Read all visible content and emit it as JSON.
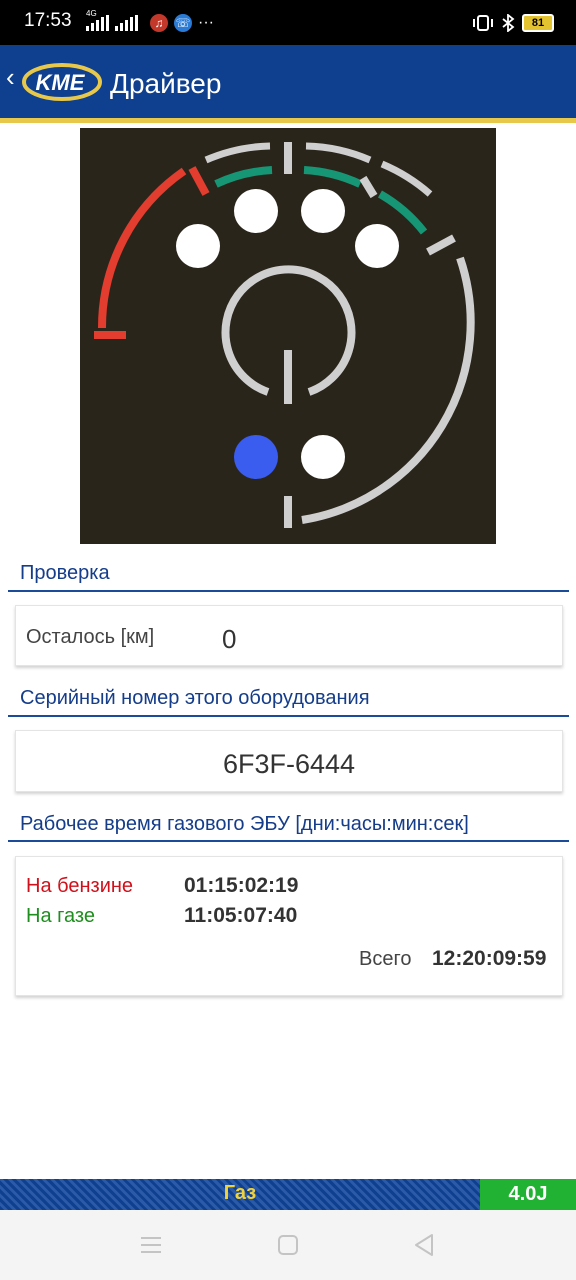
{
  "status_bar": {
    "time": "17:53",
    "network": "4G",
    "battery": "81",
    "more": "···",
    "icons": [
      "signal-icon",
      "music-icon",
      "phone-icon",
      "vibrate-icon",
      "bluetooth-icon",
      "battery-icon"
    ]
  },
  "app_bar": {
    "title": "Драйвер",
    "logo_text": "KME",
    "color": "#0f3f8f",
    "accent": "#e7c84a"
  },
  "gauge": {
    "background": "#2a251b",
    "active_indicator_color": "#3a5df0",
    "red_zone_color": "#e23d2e",
    "green_zone_color": "#179675"
  },
  "check_section": {
    "title": "Проверка",
    "remaining_label": "Осталось [км]",
    "remaining_value": "0"
  },
  "serial_section": {
    "title": "Серийный номер этого оборудования",
    "serial": "6F3F-6444"
  },
  "runtime_section": {
    "title": "Рабочее время газового ЭБУ [дни:часы:мин:сек]",
    "petrol_label": "На бензине",
    "petrol_time": "01:15:02:19",
    "gas_label": "На газе",
    "gas_time": "11:05:07:40",
    "total_label": "Всего",
    "total_time": "12:20:09:59",
    "petrol_color": "#d0101a",
    "gas_color": "#1e8e1e"
  },
  "footer": {
    "fuel": "Газ",
    "version": "4.0J"
  },
  "nav": {
    "menu": "menu-icon",
    "home": "home-icon",
    "back": "back-icon"
  }
}
